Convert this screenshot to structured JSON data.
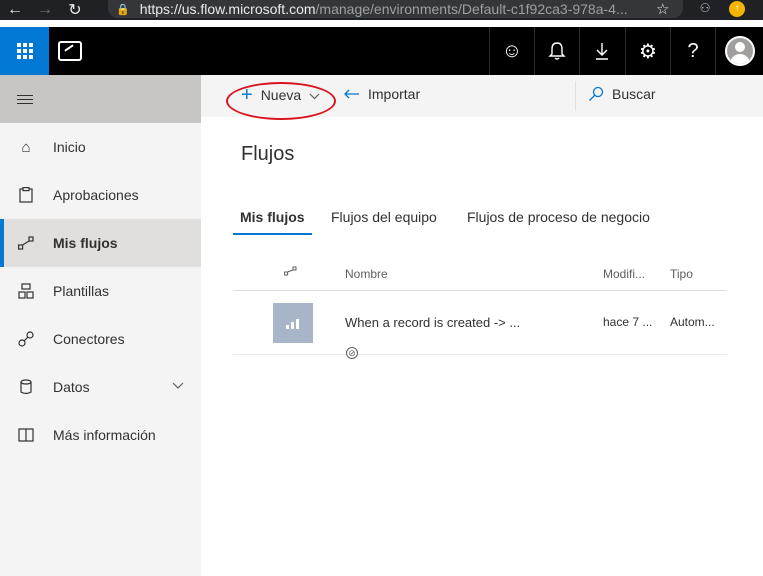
{
  "browser": {
    "back_icon": "arrow-left-icon",
    "forward_icon": "arrow-right-icon",
    "reload_icon": "reload-icon",
    "url_host": "https://us.flow.microsoft.com",
    "url_path": "/manage/environments/Default-c1f92ca3-978a-4..."
  },
  "header": {
    "icons": [
      "smiley-icon",
      "bell-icon",
      "download-icon",
      "gear-icon",
      "help-icon",
      "avatar"
    ],
    "help_label": "?",
    "accent_color": "#0078d4"
  },
  "toolbar": {
    "new_label": "Nueva",
    "import_label": "Importar",
    "search_label": "Buscar"
  },
  "sidebar": {
    "items": [
      {
        "label": "Inicio",
        "icon": "home-icon"
      },
      {
        "label": "Aprobaciones",
        "icon": "clipboard-icon"
      },
      {
        "label": "Mis flujos",
        "icon": "flow-icon"
      },
      {
        "label": "Plantillas",
        "icon": "templates-icon"
      },
      {
        "label": "Conectores",
        "icon": "connector-icon"
      },
      {
        "label": "Datos",
        "icon": "database-icon"
      },
      {
        "label": "Más información",
        "icon": "book-icon"
      }
    ]
  },
  "main": {
    "title": "Flujos",
    "tabs": [
      {
        "label": "Mis flujos",
        "active": true
      },
      {
        "label": "Flujos del equipo",
        "active": false
      },
      {
        "label": "Flujos de proceso de negocio",
        "active": false
      }
    ],
    "table": {
      "headers": [
        "Nombre",
        "Modifi...",
        "Tipo"
      ],
      "rows": [
        {
          "name": "When a record is created -> ...",
          "modified": "hace 7 ...",
          "type": "Autom..."
        }
      ]
    }
  }
}
